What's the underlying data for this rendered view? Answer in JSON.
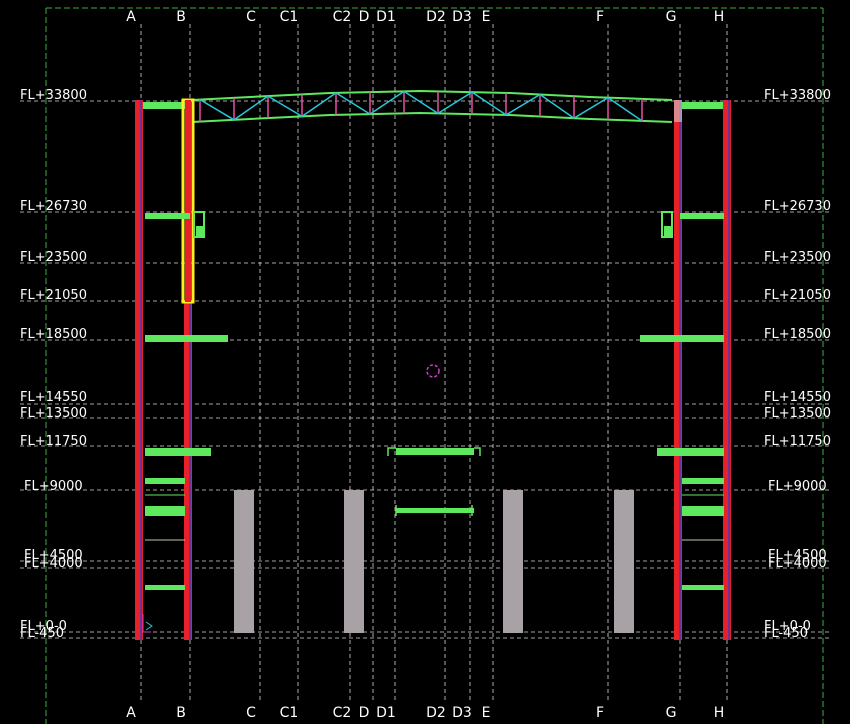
{
  "grid_axes": [
    "A",
    "B",
    "C",
    "C1",
    "C2",
    "D",
    "D1",
    "D2",
    "D3",
    "E",
    "F",
    "G",
    "H"
  ],
  "floor_levels": [
    {
      "label": "FL+33800"
    },
    {
      "label": "FL+26730"
    },
    {
      "label": "FL+23500"
    },
    {
      "label": "FL+21050"
    },
    {
      "label": "FL+18500"
    },
    {
      "label": "FL+14550"
    },
    {
      "label": "FL+13500"
    },
    {
      "label": "FL+11750"
    },
    {
      "label": "FL+9000"
    },
    {
      "label": "FL+4500"
    },
    {
      "label": "FL+4000"
    },
    {
      "label": "FL+0-0"
    },
    {
      "label": "FL-450"
    }
  ],
  "colors": {
    "background": "#000000",
    "grid_line": "#d8d8d8",
    "border": "#3fae3f",
    "column": "#e8202a",
    "column_core": "#3a3ab8",
    "highlight_column": "#ffee22",
    "beam": "#5ee85e",
    "truss_diagonal": "#27c7d9",
    "truss_vertical": "#e84fa8",
    "pier": "#a8a2a6",
    "marker": "#d23cd2"
  }
}
